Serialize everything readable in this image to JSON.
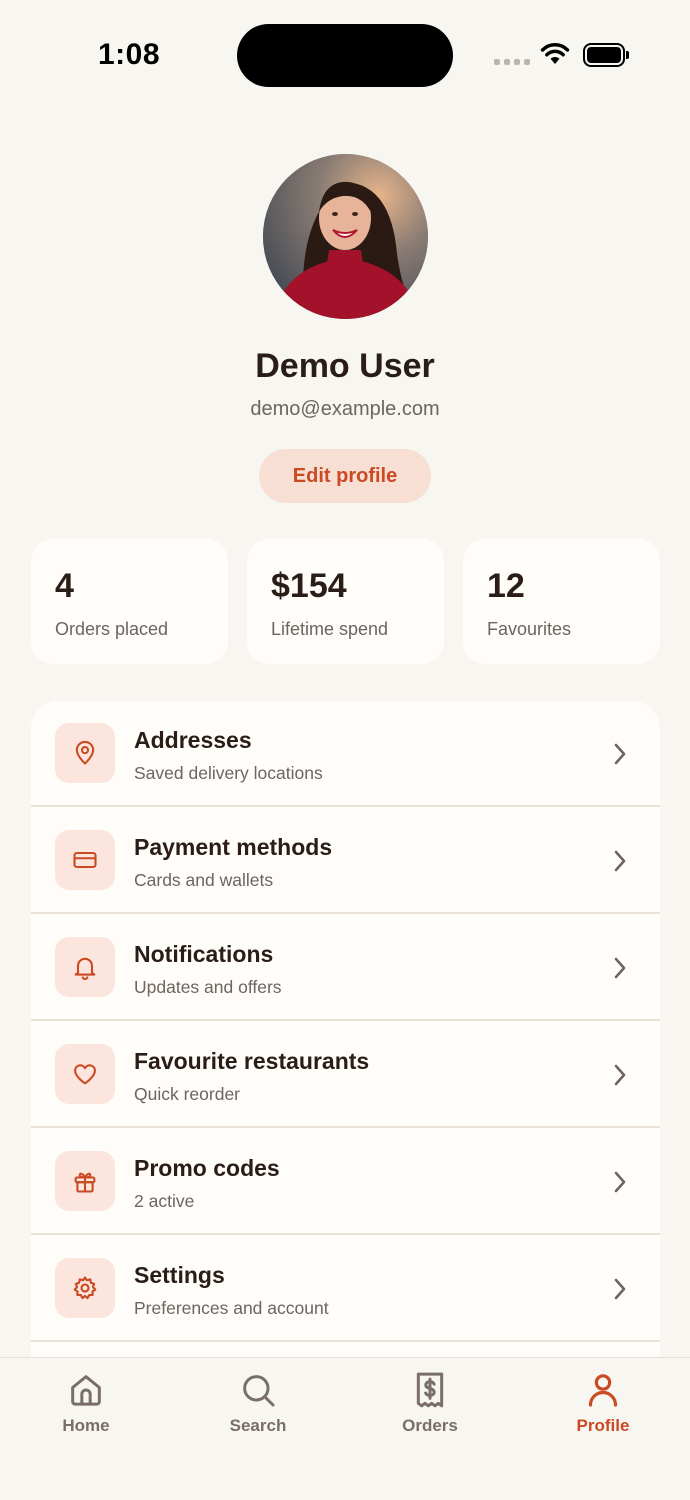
{
  "status_bar": {
    "time": "1:08"
  },
  "profile": {
    "name": "Demo User",
    "email": "demo@example.com",
    "edit_label": "Edit profile"
  },
  "stats": [
    {
      "value": "4",
      "label": "Orders placed"
    },
    {
      "value": "$154",
      "label": "Lifetime spend"
    },
    {
      "value": "12",
      "label": "Favourites"
    }
  ],
  "menu": [
    {
      "title": "Addresses",
      "subtitle": "Saved delivery locations",
      "icon": "location-pin-icon"
    },
    {
      "title": "Payment methods",
      "subtitle": "Cards and wallets",
      "icon": "credit-card-icon"
    },
    {
      "title": "Notifications",
      "subtitle": "Updates and offers",
      "icon": "bell-icon"
    },
    {
      "title": "Favourite restaurants",
      "subtitle": "Quick reorder",
      "icon": "heart-icon"
    },
    {
      "title": "Promo codes",
      "subtitle": "2 active",
      "icon": "gift-icon"
    },
    {
      "title": "Settings",
      "subtitle": "Preferences and account",
      "icon": "gear-icon"
    }
  ],
  "tabs": [
    {
      "label": "Home",
      "icon": "home-icon"
    },
    {
      "label": "Search",
      "icon": "search-icon"
    },
    {
      "label": "Orders",
      "icon": "receipt-icon"
    },
    {
      "label": "Profile",
      "icon": "person-icon",
      "active": true
    }
  ],
  "colors": {
    "accent": "#c94a23",
    "accent_soft": "#f7dfd4",
    "background": "#f8f6f1",
    "card": "#fffdf9",
    "text": "#2a1c17",
    "muted": "#6e6460"
  }
}
